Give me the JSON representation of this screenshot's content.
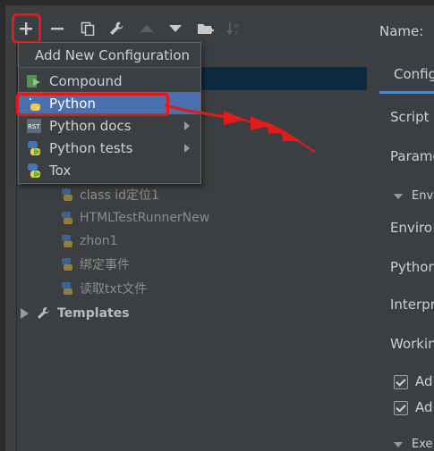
{
  "toolbar": {
    "add": "+",
    "remove": "−"
  },
  "popup": {
    "title": "Add New Configuration",
    "items": [
      {
        "label": "Compound",
        "icon": "compound-icon",
        "submenu": false
      },
      {
        "label": "Python",
        "icon": "python-icon",
        "submenu": false,
        "selected": true
      },
      {
        "label": "Python docs",
        "icon": "rst-docs-icon",
        "submenu": true
      },
      {
        "label": "Python tests",
        "icon": "python-tests-icon",
        "submenu": true
      },
      {
        "label": "Tox",
        "icon": "tox-icon",
        "submenu": false
      }
    ]
  },
  "tree": {
    "items": [
      {
        "label": "class id定位1"
      },
      {
        "label": "HTMLTestRunnerNew"
      },
      {
        "label": "zhon1"
      },
      {
        "label": "绑定事件"
      },
      {
        "label": "读取txt文件"
      }
    ],
    "templates_label": "Templates"
  },
  "right_panel": {
    "name_label": "Name:",
    "tab_label": "Configu",
    "fields": [
      "Script p",
      "Parame",
      "Enviro",
      "Python",
      "Interpr",
      "Workin"
    ],
    "section_env": "Envi",
    "section_exec": "Exe",
    "checkboxes": [
      "Ad",
      "Ad"
    ]
  },
  "colors": {
    "background": "#3c3f41",
    "selection": "#4b6eaf",
    "annotation_red": "#e31a1a",
    "tab_underline": "#4a88c7"
  }
}
